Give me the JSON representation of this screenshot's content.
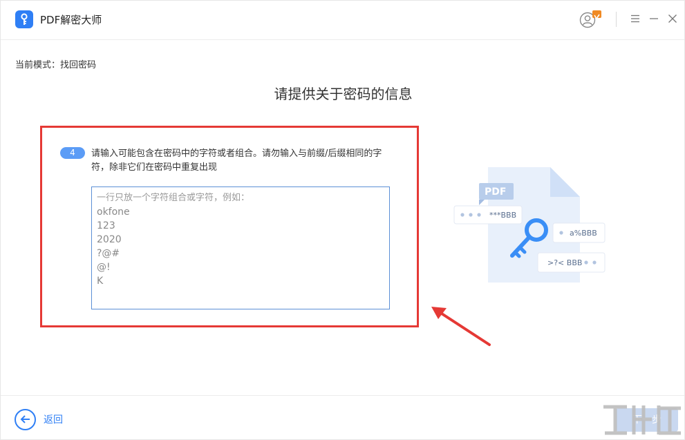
{
  "window": {
    "title": "PDF解密大师",
    "icons": {
      "logo": "key-logo-icon",
      "user": "user-account-icon",
      "menu": "menu-icon",
      "minimize": "minimize-icon",
      "close": "close-icon"
    }
  },
  "mode": {
    "label": "当前模式：找回密码"
  },
  "page": {
    "title": "请提供关于密码的信息"
  },
  "step": {
    "number": "4",
    "instruction": "请输入可能包含在密码中的字符或者组合。请勿输入与前缀/后缀相同的字符，除非它们在密码中重复出现",
    "input_placeholder_hint": "一行只放一个字符组合或字符，例如：",
    "input_examples": [
      "okfone",
      "123",
      "2020",
      "?@#",
      "@!",
      "K"
    ]
  },
  "illustration": {
    "pdf_label": "PDF",
    "cards": [
      "***BBB",
      "a%BBB",
      ">?< BBB"
    ]
  },
  "footer": {
    "back_label": "返回",
    "next_label": "下一步"
  },
  "colors": {
    "accent": "#2f7ff5",
    "highlight_border": "#e53935",
    "badge": "#5b9cf6",
    "next_disabled": "#c9d8f0"
  }
}
